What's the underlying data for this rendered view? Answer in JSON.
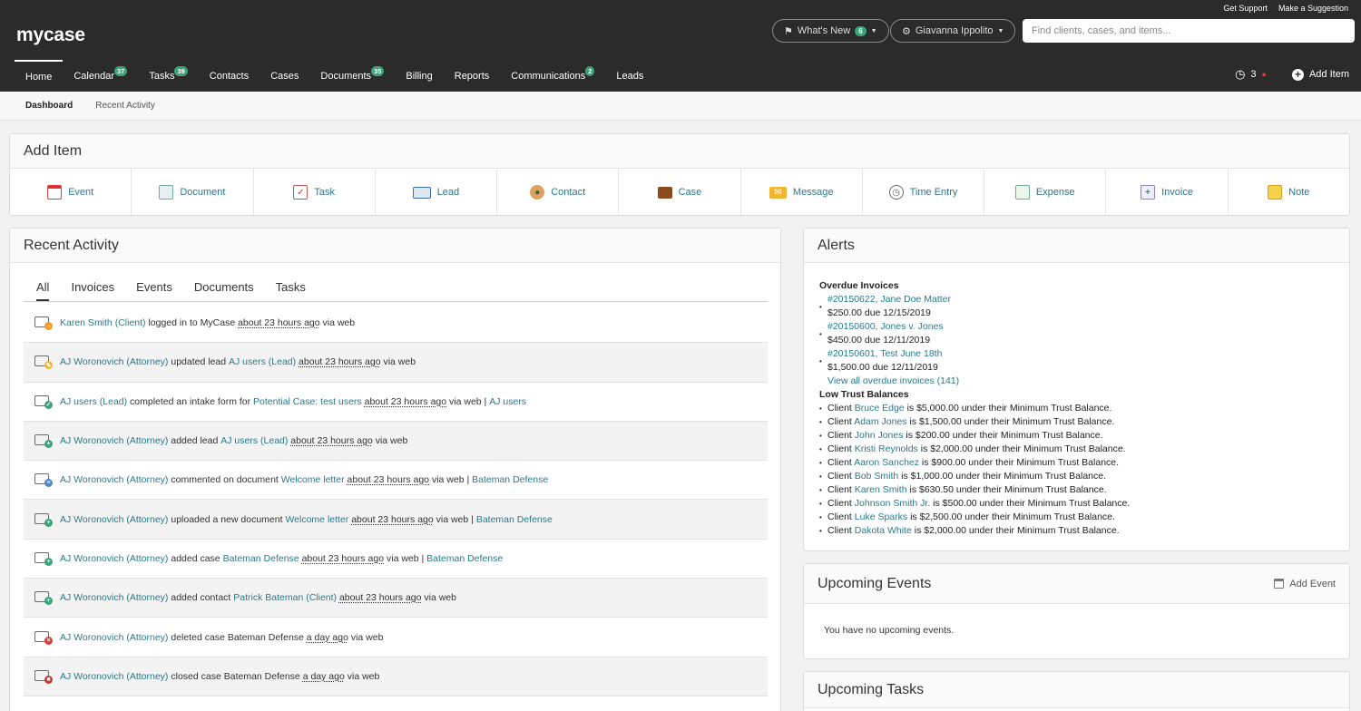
{
  "header": {
    "logo": "mycase",
    "get_support": "Get Support",
    "make_suggestion": "Make a Suggestion",
    "whats_new": "What's New",
    "whats_new_count": "6",
    "user": "Giavanna Ippolito",
    "search_placeholder": "Find clients, cases, and items...",
    "timer_count": "3",
    "add_item": "Add Item"
  },
  "nav": [
    {
      "label": "Home",
      "count": ""
    },
    {
      "label": "Calendar",
      "count": "37"
    },
    {
      "label": "Tasks",
      "count": "39"
    },
    {
      "label": "Contacts",
      "count": ""
    },
    {
      "label": "Cases",
      "count": ""
    },
    {
      "label": "Documents",
      "count": "35"
    },
    {
      "label": "Billing",
      "count": ""
    },
    {
      "label": "Reports",
      "count": ""
    },
    {
      "label": "Communications",
      "count": "2"
    },
    {
      "label": "Leads",
      "count": ""
    }
  ],
  "subnav": {
    "dashboard": "Dashboard",
    "recent": "Recent Activity"
  },
  "add_item_panel": {
    "title": "Add Item",
    "items": [
      "Event",
      "Document",
      "Task",
      "Lead",
      "Contact",
      "Case",
      "Message",
      "Time Entry",
      "Expense",
      "Invoice",
      "Note"
    ]
  },
  "recent": {
    "title": "Recent Activity",
    "tabs": [
      "All",
      "Invoices",
      "Events",
      "Documents",
      "Tasks"
    ],
    "rows": [
      {
        "a": "Karen Smith (Client)",
        "t1": " logged in to MyCase ",
        "when": "about 23 hours ago",
        "t2": " via web",
        "l2": "",
        "t3": "",
        "l3": ""
      },
      {
        "a": "AJ Woronovich (Attorney)",
        "t1": " updated lead ",
        "l2": "AJ users (Lead)",
        "sp": " ",
        "when": "about 23 hours ago",
        "t2": " via web",
        "t3": "",
        "l3": ""
      },
      {
        "a": "AJ users (Lead)",
        "t1": " completed an intake form for ",
        "l2": "Potential Case: test users",
        "sp": " ",
        "when": "about 23 hours ago",
        "t2": " via web | ",
        "l3": "AJ users"
      },
      {
        "a": "AJ Woronovich (Attorney)",
        "t1": " added lead ",
        "l2": "AJ users (Lead)",
        "sp": " ",
        "when": "about 23 hours ago",
        "t2": " via web",
        "l3": ""
      },
      {
        "a": "AJ Woronovich (Attorney)",
        "t1": " commented on document ",
        "l2": "Welcome letter",
        "sp": " ",
        "when": "about 23 hours ago",
        "t2": " via web | ",
        "l3": "Bateman Defense"
      },
      {
        "a": "AJ Woronovich (Attorney)",
        "t1": " uploaded a new document ",
        "l2": "Welcome letter",
        "sp": " ",
        "when": "about 23 hours ago",
        "t2": " via web | ",
        "l3": "Bateman Defense"
      },
      {
        "a": "AJ Woronovich (Attorney)",
        "t1": " added case ",
        "l2": "Bateman Defense",
        "sp": " ",
        "when": "about 23 hours ago",
        "t2": " via web | ",
        "l3": "Bateman Defense"
      },
      {
        "a": "AJ Woronovich (Attorney)",
        "t1": " added contact ",
        "l2": "Patrick Bateman (Client)",
        "sp": " ",
        "when": "about 23 hours ago",
        "t2": " via web",
        "l3": ""
      },
      {
        "a": "AJ Woronovich (Attorney)",
        "t1": " deleted case Bateman Defense ",
        "l2": "",
        "sp": "",
        "when": "a day ago",
        "t2": " via web",
        "l3": ""
      },
      {
        "a": "AJ Woronovich (Attorney)",
        "t1": " closed case Bateman Defense ",
        "l2": "",
        "sp": "",
        "when": "a day ago",
        "t2": " via web",
        "l3": ""
      }
    ]
  },
  "alerts": {
    "title": "Alerts",
    "overdue_title": "Overdue Invoices",
    "overdue": [
      {
        "link": "#20150622, Jane Doe Matter",
        "amount": "$250.00 due 12/15/2019"
      },
      {
        "link": "#20150600, Jones v. Jones",
        "amount": "$450.00 due 12/11/2019"
      },
      {
        "link": "#20150601, Test June 18th",
        "amount": "$1,500.00 due 12/11/2019"
      }
    ],
    "view_all": "View all overdue invoices (141)",
    "low_trust_title": "Low Trust Balances",
    "client_word": "Client",
    "trust": [
      {
        "name": "Bruce Edge",
        "text": " is $5,000.00 under their Minimum Trust Balance."
      },
      {
        "name": "Adam Jones",
        "text": " is $1,500.00 under their Minimum Trust Balance."
      },
      {
        "name": "John Jones",
        "text": " is $200.00 under their Minimum Trust Balance."
      },
      {
        "name": "Kristi Reynolds",
        "text": " is $2,000.00 under their Minimum Trust Balance."
      },
      {
        "name": "Aaron Sanchez",
        "text": " is $900.00 under their Minimum Trust Balance."
      },
      {
        "name": "Bob Smith",
        "text": " is $1,000.00 under their Minimum Trust Balance."
      },
      {
        "name": "Karen Smith",
        "text": " is $630.50 under their Minimum Trust Balance."
      },
      {
        "name": "Johnson Smith Jr.",
        "text": " is $500.00 under their Minimum Trust Balance."
      },
      {
        "name": "Luke Sparks",
        "text": " is $2,500.00 under their Minimum Trust Balance."
      },
      {
        "name": "Dakota White",
        "text": " is $2,000.00 under their Minimum Trust Balance."
      }
    ]
  },
  "events": {
    "title": "Upcoming Events",
    "add": "Add Event",
    "empty": "You have no upcoming events."
  },
  "tasks": {
    "title": "Upcoming Tasks"
  },
  "colors": {
    "accent": "#3aa37a",
    "link": "#2a7a8c",
    "header": "#2b2b2b",
    "alert_dot": "#e53935"
  }
}
